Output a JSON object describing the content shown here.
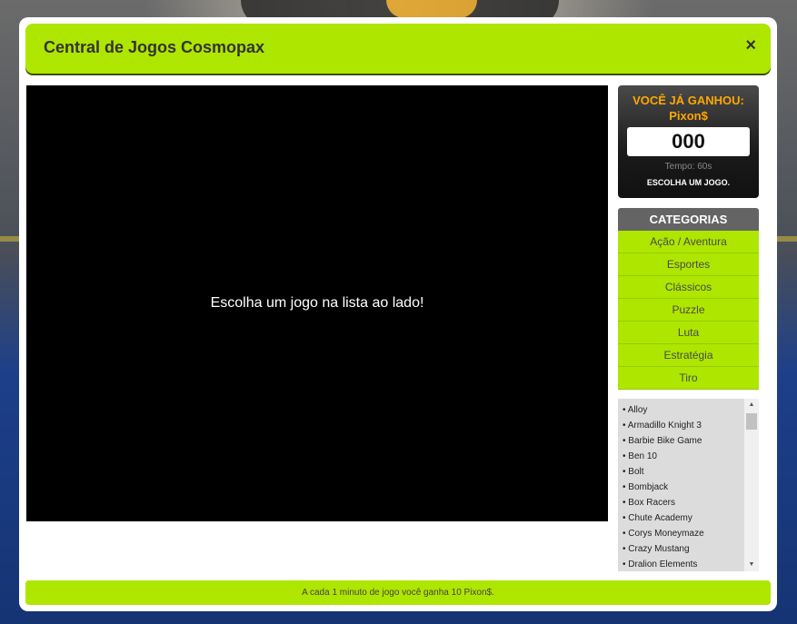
{
  "modal": {
    "title": "Central de Jogos Cosmopax",
    "close_label": "×"
  },
  "game": {
    "prompt": "Escolha um jogo na lista ao lado!"
  },
  "score": {
    "won_line1": "VOCÊ JÁ GANHOU:",
    "won_line2": "Pixon$",
    "value": "000",
    "time": "Tempo: 60s",
    "status": "ESCOLHA UM JOGO."
  },
  "categories": {
    "header": "CATEGORIAS",
    "items": [
      "Ação / Aventura",
      "Esportes",
      "Clássicos",
      "Puzzle",
      "Luta",
      "Estratégia",
      "Tiro"
    ]
  },
  "games": [
    "• Alloy",
    "• Armadillo Knight 3",
    "• Barbie Bike Game",
    "• Ben 10",
    "• Bolt",
    "• Bombjack",
    "• Box Racers",
    "• Chute Academy",
    "• Corys Moneymaze",
    "• Crazy Mustang",
    "• Dralion Elements"
  ],
  "footer": {
    "text": "A cada 1 minuto de jogo você ganha 10 Pixon$."
  },
  "colors": {
    "accent": "#aee600",
    "score_label": "#ffa800",
    "category_header": "#646464"
  }
}
